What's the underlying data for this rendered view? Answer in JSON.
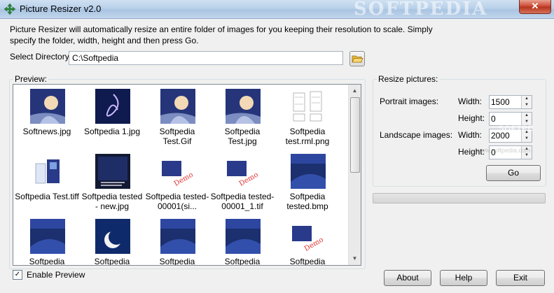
{
  "window": {
    "title": "Picture Resizer v2.0",
    "watermark": "SOFTPEDIA",
    "close_label": "✕"
  },
  "description": "Picture Resizer will automatically resize an entire folder of images for you keeping their resolution to scale. Simply specify the folder, width, height and then press Go.",
  "directory": {
    "label": "Select Directory:",
    "value": "C:\\Softpedia",
    "browse_icon": "folder-open-icon"
  },
  "preview": {
    "label": "Preview:",
    "items": [
      {
        "caption": "Softnews.jpg",
        "kind": "portrait"
      },
      {
        "caption": "Softpedia 1.jpg",
        "kind": "swirl"
      },
      {
        "caption": "Softpedia Test.Gif",
        "kind": "portrait"
      },
      {
        "caption": "Softpedia Test.jpg",
        "kind": "portrait"
      },
      {
        "caption": "Softpedia test.rml.png",
        "kind": "doc"
      },
      {
        "caption": "Softpedia Test.tiff",
        "kind": "boxes"
      },
      {
        "caption": "Softpedia tested - new.jpg",
        "kind": "dark"
      },
      {
        "caption": "Softpedia tested-00001(si...",
        "kind": "demo"
      },
      {
        "caption": "Softpedia tested-00001_1.tif",
        "kind": "demo"
      },
      {
        "caption": "Softpedia tested.bmp",
        "kind": "blue"
      },
      {
        "caption": "Softpedia",
        "kind": "blue"
      },
      {
        "caption": "Softpedia",
        "kind": "moon"
      },
      {
        "caption": "Softpedia",
        "kind": "blue"
      },
      {
        "caption": "Softpedia",
        "kind": "blue"
      },
      {
        "caption": "Softpedia",
        "kind": "demo"
      }
    ],
    "enable_label": "Enable Preview",
    "enable_checked": true
  },
  "resize": {
    "label": "Resize pictures:",
    "portrait_label": "Portrait images:",
    "landscape_label": "Landscape images:",
    "width_label": "Width:",
    "height_label": "Height:",
    "portrait_width": "1500",
    "portrait_height": "0",
    "landscape_width": "2000",
    "landscape_height": "0",
    "go_label": "Go",
    "overlay_text": "SOFTPE",
    "overlay_small": "www.softpedia.com"
  },
  "progress": 0,
  "buttons": {
    "about": "About",
    "help": "Help",
    "exit": "Exit"
  },
  "colors": {
    "title_bar": "#b9d1ea",
    "close_red": "#c8452f",
    "thumb_blue": "#1c2f6e"
  }
}
